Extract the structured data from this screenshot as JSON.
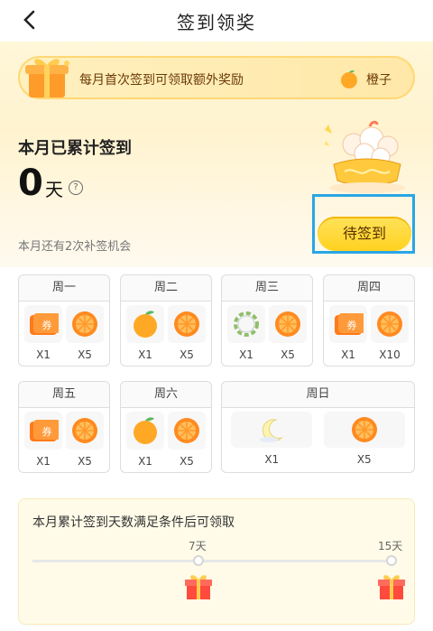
{
  "header": {
    "title": "签到领奖"
  },
  "banner": {
    "text": "每月首次签到可领取额外奖励",
    "orange_label": "橙子"
  },
  "summary": {
    "accumulated_label": "本月已累计签到",
    "days": "0",
    "unit": "天",
    "remain_text": "本月还有2次补签机会"
  },
  "sign_button": {
    "label": "待签到"
  },
  "week": [
    {
      "day": "周一",
      "rewards": [
        {
          "icon": "coupon-icon",
          "count": "X1"
        },
        {
          "icon": "orange-slice-icon",
          "count": "X5"
        }
      ]
    },
    {
      "day": "周二",
      "rewards": [
        {
          "icon": "orange-icon",
          "count": "X1"
        },
        {
          "icon": "orange-slice-icon",
          "count": "X5"
        }
      ]
    },
    {
      "day": "周三",
      "rewards": [
        {
          "icon": "wreath-icon",
          "count": "X1"
        },
        {
          "icon": "orange-slice-icon",
          "count": "X5"
        }
      ]
    },
    {
      "day": "周四",
      "rewards": [
        {
          "icon": "coupon-icon",
          "count": "X1"
        },
        {
          "icon": "orange-slice-icon",
          "count": "X10"
        }
      ]
    },
    {
      "day": "周五",
      "rewards": [
        {
          "icon": "coupon-icon",
          "count": "X1"
        },
        {
          "icon": "orange-slice-icon",
          "count": "X5"
        }
      ]
    },
    {
      "day": "周六",
      "rewards": [
        {
          "icon": "orange-icon",
          "count": "X1"
        },
        {
          "icon": "orange-slice-icon",
          "count": "X5"
        }
      ]
    },
    {
      "day": "周日",
      "rewards": [
        {
          "icon": "moon-icon",
          "count": "X1"
        },
        {
          "icon": "orange-slice-icon",
          "count": "X5"
        }
      ]
    }
  ],
  "goal": {
    "title": "本月累计签到天数满足条件后可领取",
    "milestones": [
      {
        "label": "7天"
      },
      {
        "label": "15天"
      }
    ]
  }
}
